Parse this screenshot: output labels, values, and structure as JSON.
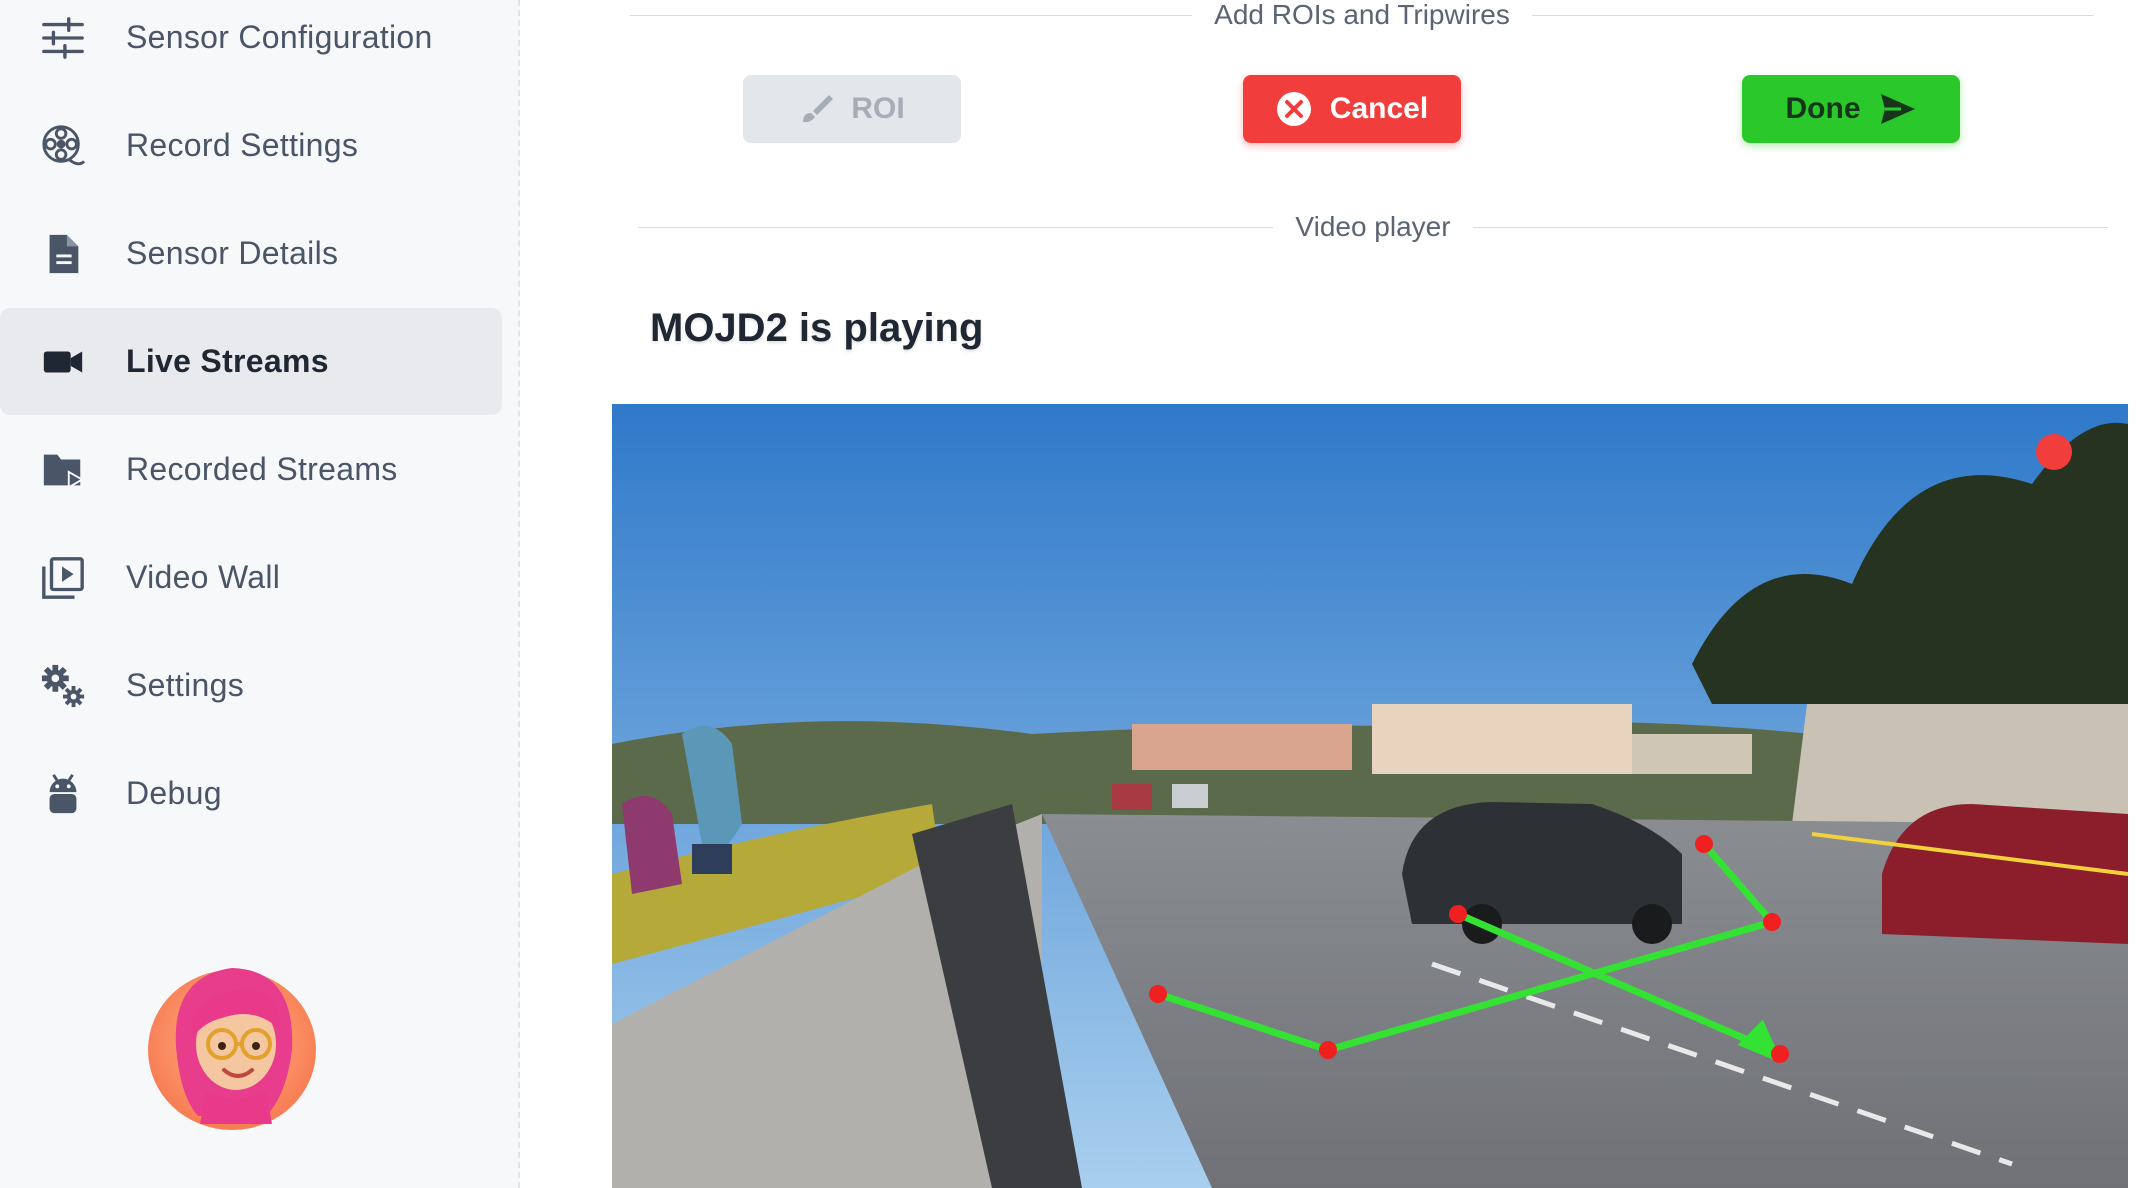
{
  "sidebar": {
    "items": [
      {
        "label": "Sensor Configuration",
        "icon": "sliders-icon"
      },
      {
        "label": "Record Settings",
        "icon": "film-reel-icon"
      },
      {
        "label": "Sensor Details",
        "icon": "document-icon"
      },
      {
        "label": "Live Streams",
        "icon": "video-camera-icon",
        "active": true
      },
      {
        "label": "Recorded Streams",
        "icon": "folder-play-icon"
      },
      {
        "label": "Video Wall",
        "icon": "video-library-icon"
      },
      {
        "label": "Settings",
        "icon": "gears-icon"
      },
      {
        "label": "Debug",
        "icon": "android-icon"
      }
    ]
  },
  "roi_section": {
    "title": "Add ROIs and Tripwires",
    "roi_button": "ROI",
    "cancel_button": "Cancel",
    "done_button": "Done"
  },
  "player_section": {
    "title": "Video player",
    "playing_text": "MOJD2 is playing"
  },
  "colors": {
    "cancel": "#f23d3d",
    "done": "#2bc82b",
    "roi_disabled": "#e3e6ea",
    "tripwire": "#34e234",
    "tripwire_point": "#f02020",
    "recording": "#f23d3d"
  }
}
